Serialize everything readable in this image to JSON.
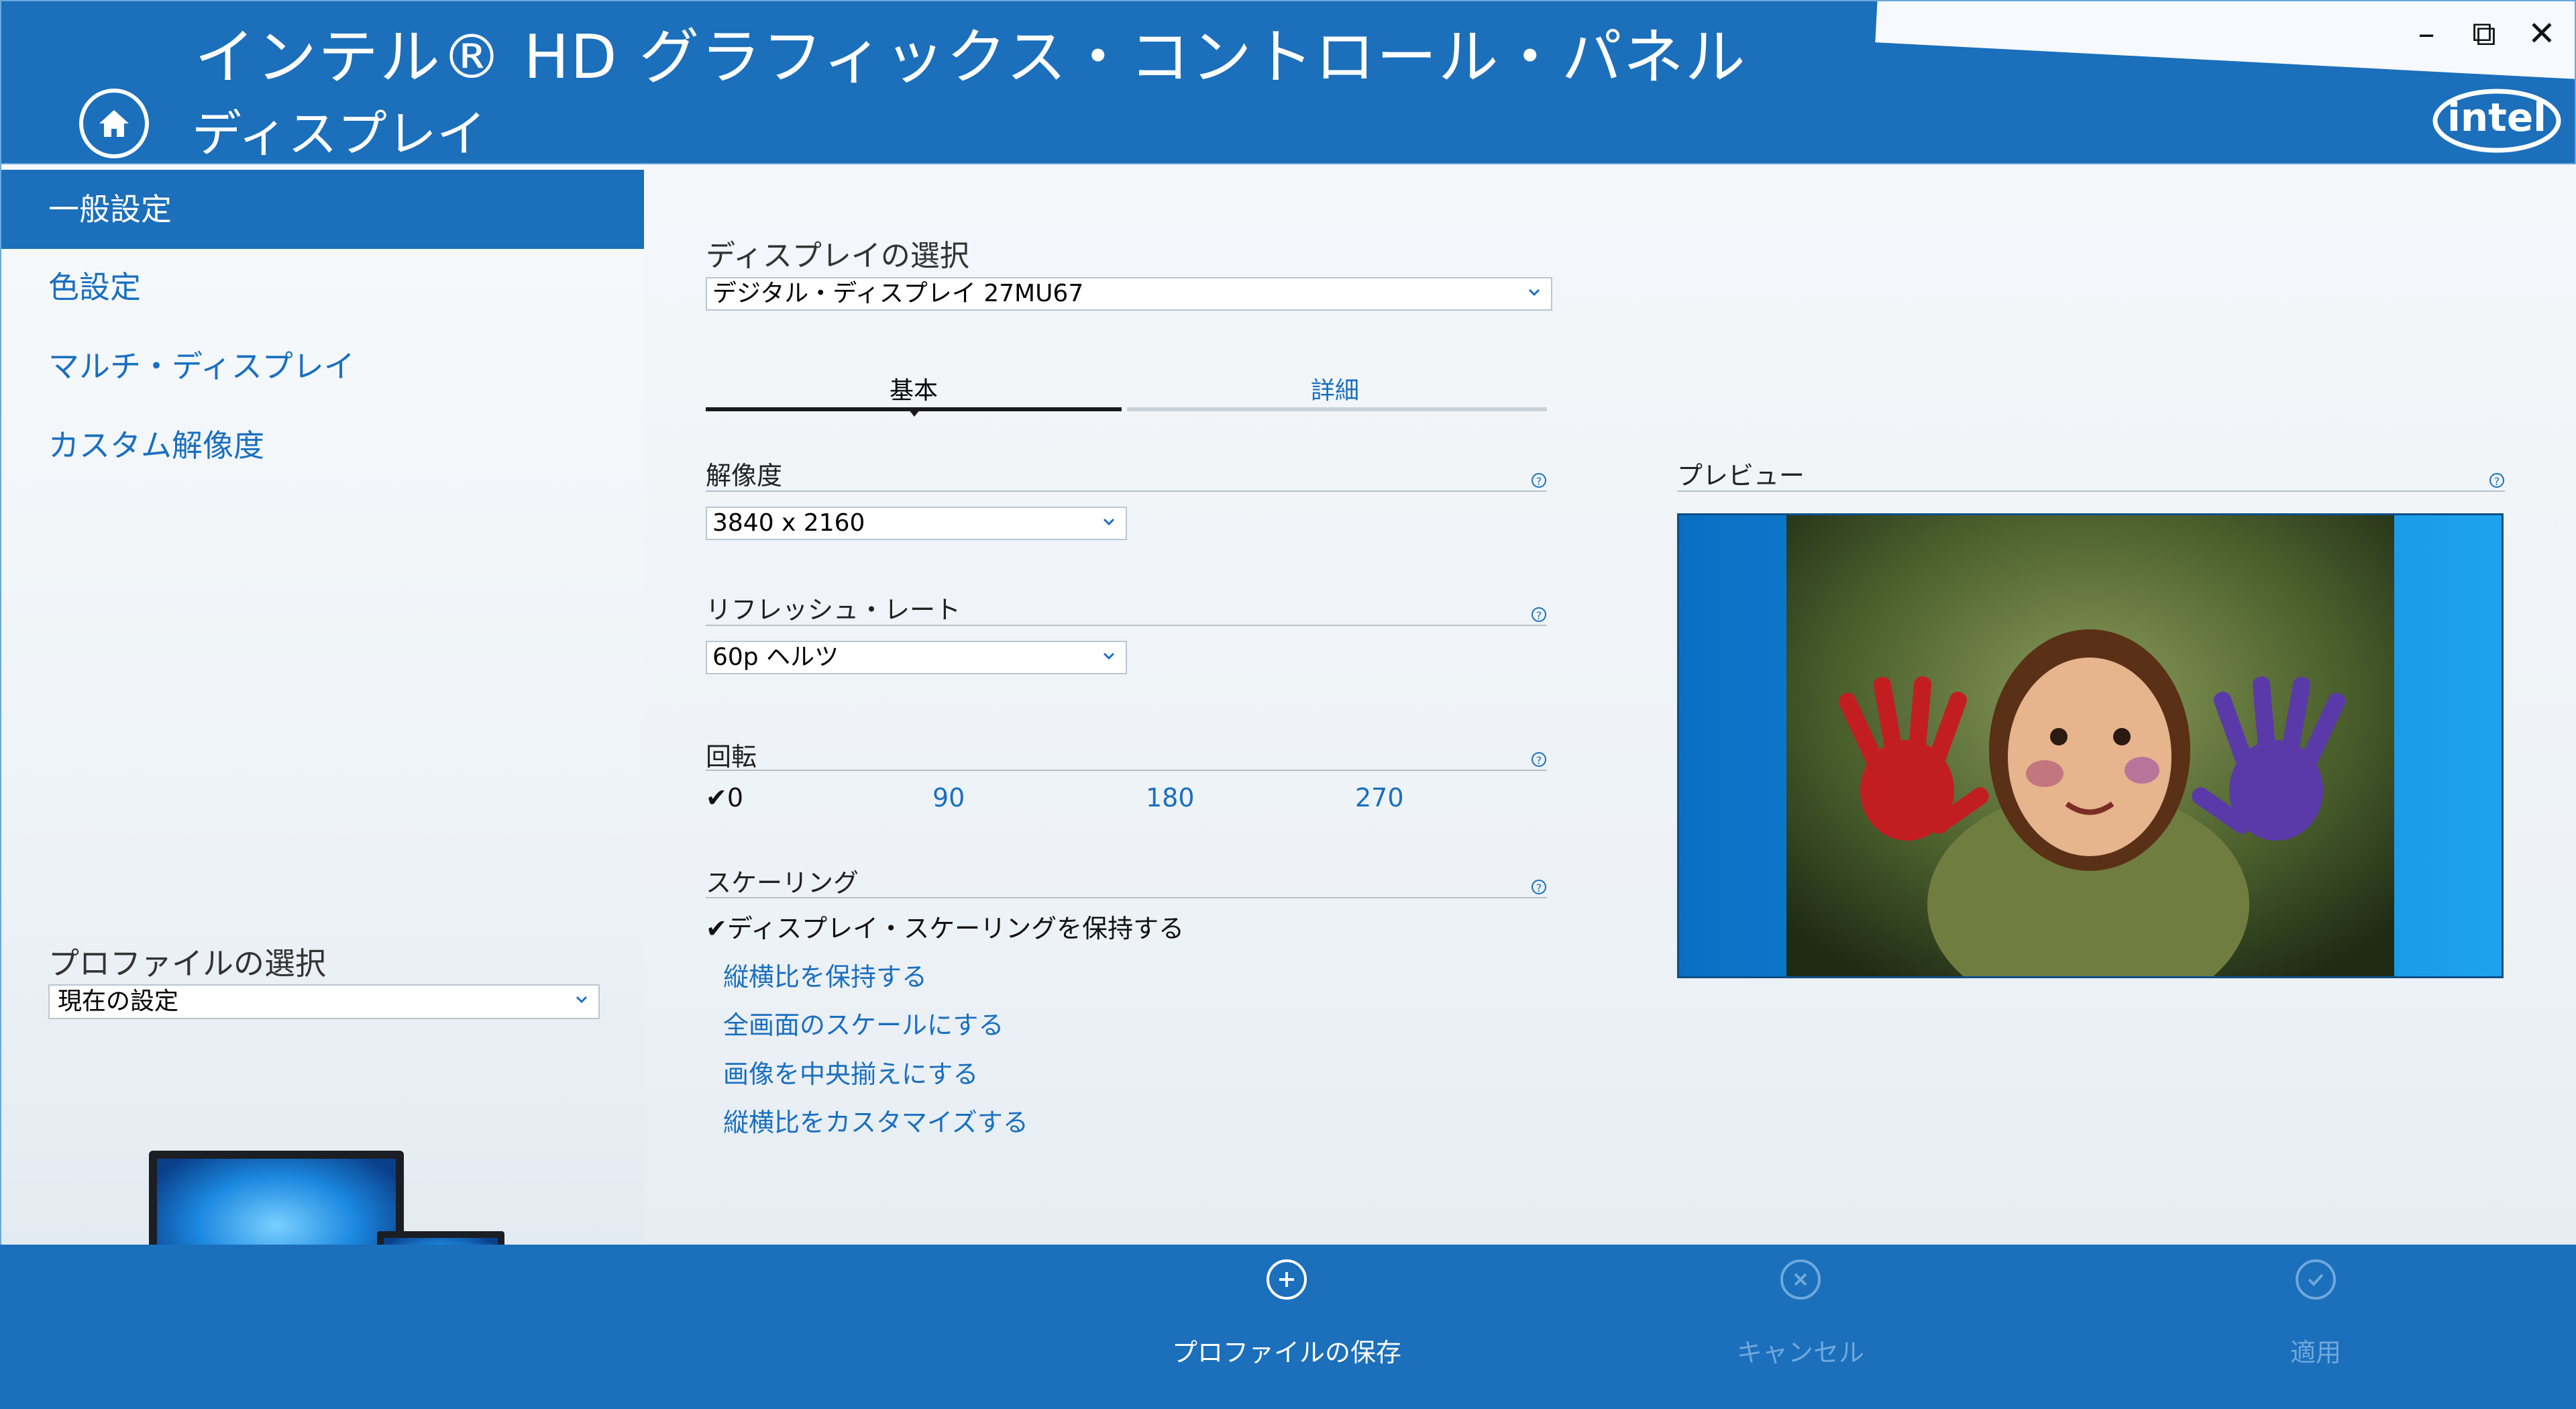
{
  "header": {
    "app_title": "インテル® HD グラフィックス・コントロール・パネル",
    "section_title": "ディスプレイ",
    "window_controls": {
      "minimize": "–",
      "restore": "⧉",
      "close": "✕"
    },
    "brand_logo_text": "intel"
  },
  "sidebar": {
    "items": [
      {
        "label": "一般設定",
        "active": true
      },
      {
        "label": "色設定",
        "active": false
      },
      {
        "label": "マルチ・ディスプレイ",
        "active": false
      },
      {
        "label": "カスタム解像度",
        "active": false
      }
    ],
    "profile_label": "プロファイルの選択",
    "profile_value": "現在の設定"
  },
  "main": {
    "display_select_label": "ディスプレイの選択",
    "display_select_value": "デジタル・ディスプレイ 27MU67",
    "tabs": [
      {
        "label": "基本"
      },
      {
        "label": "詳細"
      }
    ],
    "resolution": {
      "label": "解像度",
      "value": "3840 x 2160"
    },
    "refresh": {
      "label": "リフレッシュ・レート",
      "value": "60p ヘルツ"
    },
    "rotation": {
      "label": "回転",
      "options": [
        "✔0",
        "90",
        "180",
        "270"
      ]
    },
    "scaling": {
      "label": "スケーリング",
      "options": [
        "✔ディスプレイ・スケーリングを保持する",
        "縦横比を保持する",
        "全画面のスケールにする",
        "画像を中央揃えにする",
        "縦横比をカスタマイズする"
      ]
    },
    "help_glyph": "?",
    "preview": {
      "label": "プレビュー"
    }
  },
  "footer": {
    "save_label": "プロファイルの保存",
    "cancel_label": "キャンセル",
    "apply_label": "適用"
  },
  "colors": {
    "brand_blue": "#1b6fbb",
    "link_blue": "#1a6fc1",
    "disabled": "#6ea8dc"
  }
}
